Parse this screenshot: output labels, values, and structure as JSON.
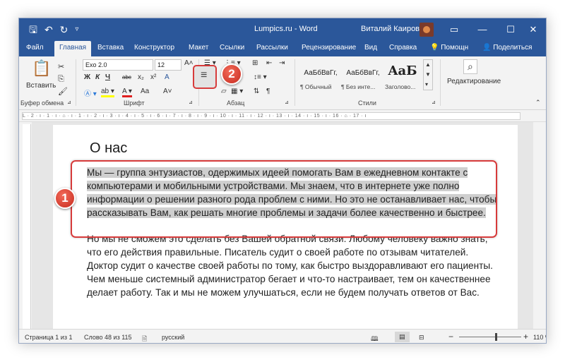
{
  "window": {
    "doc_title": "Lumpics.ru - Word",
    "user_name": "Виталий Каиров",
    "title_icons": [
      "word-save-icon",
      "undo-icon",
      "redo-icon",
      "customize-qat-icon"
    ]
  },
  "tabs": [
    "Файл",
    "Главная",
    "Вставка",
    "Конструктор",
    "Макет",
    "Ссылки",
    "Рассылки",
    "Рецензирование",
    "Вид",
    "Справка",
    "Помощн",
    "Поделиться"
  ],
  "active_tab": "Главная",
  "ribbon": {
    "paste_label": "Вставить",
    "font_name": "Exo 2.0",
    "font_size": "12",
    "bold": "Ж",
    "italic": "К",
    "underline": "Ч",
    "strike": "abc",
    "subscript": "x₂",
    "superscript": "x²",
    "grow_font": "A˄",
    "shrink_font": "A˅",
    "change_case": "Aa",
    "clear_format": "A",
    "groups": {
      "clipboard": "Буфер обмена",
      "font": "Шрифт",
      "paragraph": "Абзац",
      "styles": "Стили",
      "editing": "Редактирование"
    },
    "styles": [
      {
        "sample": "АаБбВвГг,",
        "name": "¶ Обычный"
      },
      {
        "sample": "АаБбВвГг,",
        "name": "¶ Без инте..."
      },
      {
        "sample": "AaБ",
        "name": "Заголово..."
      }
    ]
  },
  "ruler_text": "L · 2 · ı · 1 · ı · ⌂ · ı · 1 · ı · 2 · ı · 3 · ı · 4 · ı · 5 · ı · 6 · ı · 7 · ı · 8 · ı · 9 · ı · 10 · ı · 11 · ı · 12 · ı · 13 · ı · 14 · ı · 15 · ı · 16 · ⌂ · 17 · ı",
  "document": {
    "heading": "О нас",
    "para1": "Мы — группа энтузиастов, одержимых идеей помогать Вам в ежедневном контакте с компьютерами и мобильными устройствами. Мы знаем, что в интернете уже полно информации о решении разного рода проблем с ними. Но это не останавливает нас, чтобы рассказывать Вам, как решать многие проблемы и задачи более качественно и быстрее.",
    "para2": "Но мы не сможем это сделать без Вашей обратной связи. Любому человеку важно знать, что его действия правильные. Писатель судит о своей работе по отзывам читателей. Доктор судит о качестве своей работы по тому, как быстро выздоравливают его пациенты. Чем меньше системный администратор бегает и что-то настраивает, тем он качественнее делает работу. Так и мы не можем улучшаться, если не будем получать ответов от Вас."
  },
  "annotations": {
    "badge1": "1",
    "badge2": "2"
  },
  "status": {
    "page": "Страница 1 из 1",
    "words": "Слово 48 из 115",
    "language": "русский",
    "zoom": "110 %",
    "zoom_minus": "−",
    "zoom_plus": "+"
  }
}
